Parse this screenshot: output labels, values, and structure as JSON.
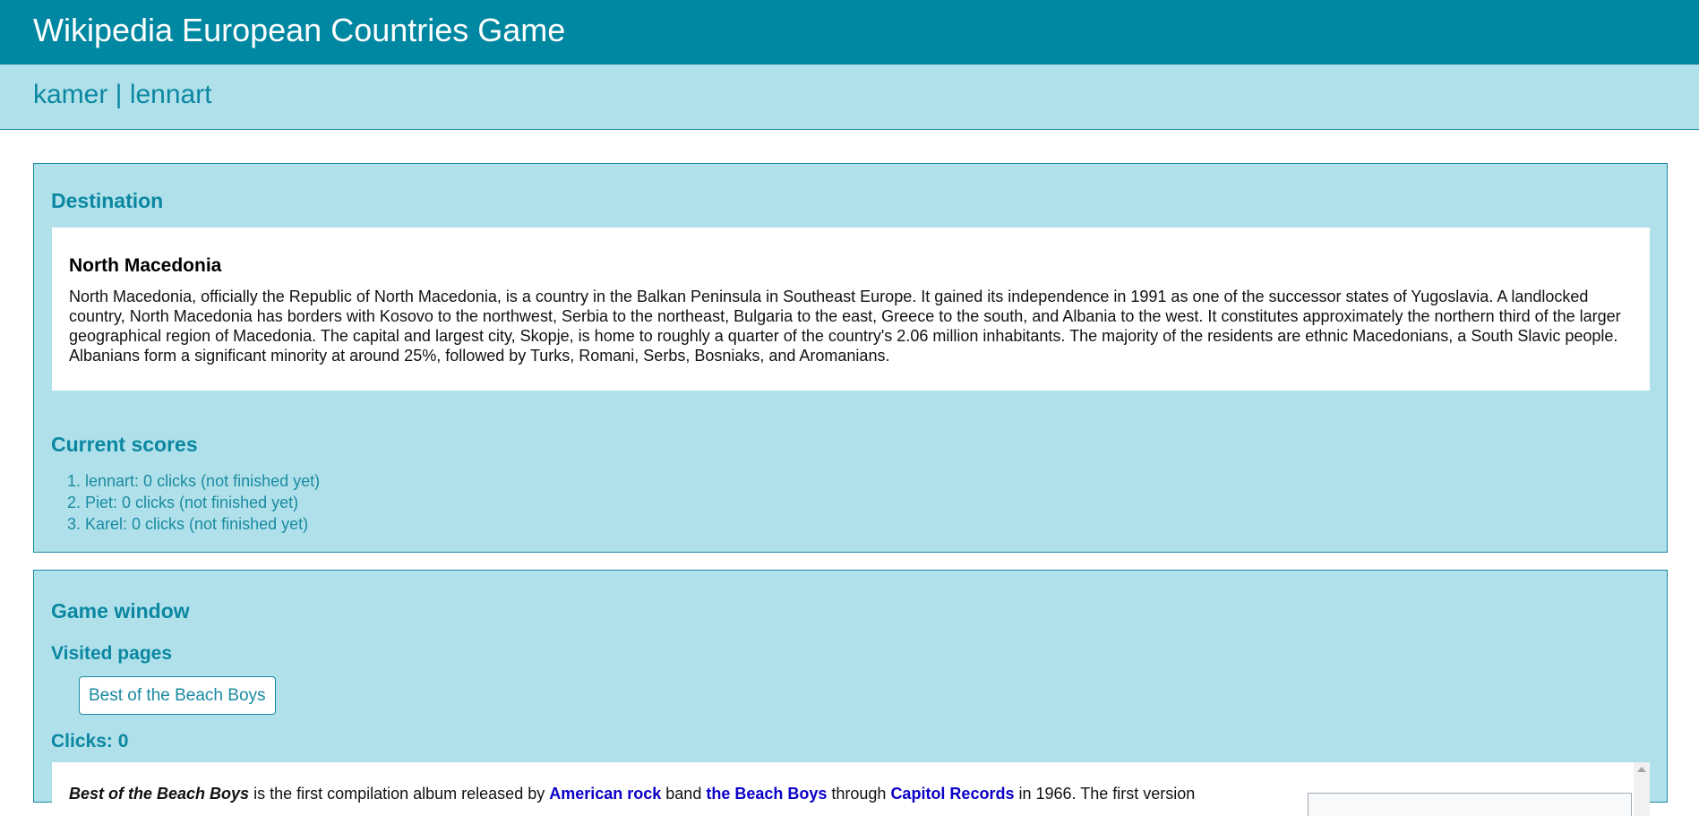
{
  "header": {
    "title": "Wikipedia European Countries Game"
  },
  "subheader": {
    "users": "kamer | lennart"
  },
  "destination": {
    "heading": "Destination",
    "name": "North Macedonia",
    "description": "North Macedonia, officially the Republic of North Macedonia, is a country in the Balkan Peninsula in Southeast Europe. It gained its independence in 1991 as one of the successor states of Yugoslavia. A landlocked country, North Macedonia has borders with Kosovo to the northwest, Serbia to the northeast, Bulgaria to the east, Greece to the south, and Albania to the west. It constitutes approximately the northern third of the larger geographical region of Macedonia. The capital and largest city, Skopje, is home to roughly a quarter of the country's 2.06 million inhabitants. The majority of the residents are ethnic Macedonians, a South Slavic people. Albanians form a significant minority at around 25%, followed by Turks, Romani, Serbs, Bosniaks, and Aromanians."
  },
  "scores": {
    "heading": "Current scores",
    "items": [
      "1. lennart: 0 clicks (not finished yet)",
      "2. Piet: 0 clicks (not finished yet)",
      "3. Karel: 0 clicks (not finished yet)"
    ]
  },
  "game": {
    "heading": "Game window",
    "visited_heading": "Visited pages",
    "visited": [
      "Best of the Beach Boys"
    ],
    "clicks_label": "Clicks: 0",
    "article": {
      "album": "Best of the Beach Boys",
      "t1": " is the first compilation album released by ",
      "link1": "American rock",
      "t2": " band ",
      "link2": "the Beach Boys",
      "t3": " through ",
      "link3": "Capitol Records",
      "t4": " in 1966. The first version"
    }
  },
  "colors": {
    "header_bg": "#0087a1",
    "panel_bg": "#b0e1eb",
    "accent": "#0b87a1",
    "link": "#0b00c8"
  }
}
